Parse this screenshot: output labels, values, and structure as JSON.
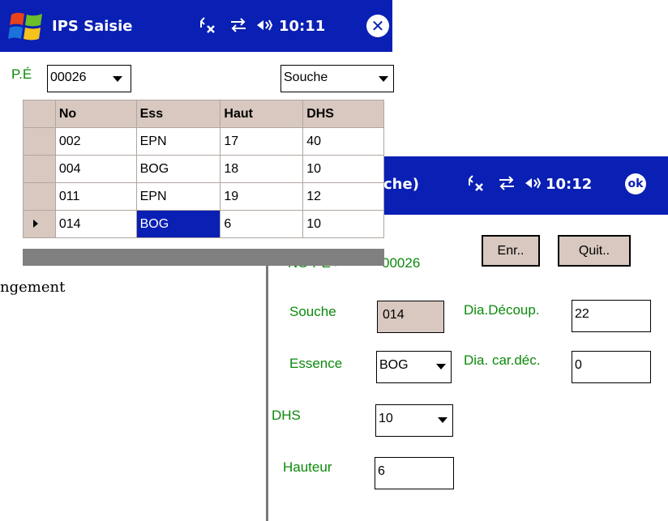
{
  "background_text": "ngement",
  "front_window": {
    "title": "IPS Saisie",
    "time": "10:11",
    "status_icons": [
      "signal-off-icon",
      "sync-icon",
      "volume-icon"
    ],
    "pe_label": "P.É",
    "pe_select": "00026",
    "type_select": "Souche",
    "grid": {
      "columns": [
        "No",
        "Ess",
        "Haut",
        "DHS"
      ],
      "rows": [
        [
          "002",
          "EPN",
          "17",
          "40"
        ],
        [
          "004",
          "BOG",
          "18",
          "10"
        ],
        [
          "011",
          "EPN",
          "19",
          "12"
        ],
        [
          "014",
          "BOG",
          "6",
          "10"
        ]
      ],
      "selected_row": 3,
      "selected_col": 1
    }
  },
  "back_window": {
    "title_fragment": "che)",
    "time": "10:12",
    "ok_label": "ok",
    "partial_label_prefix": "NO PÉ >",
    "partial_label_value": "00026",
    "save_button": "Enr..",
    "quit_button": "Quit..",
    "fields": {
      "souche_label": "Souche",
      "souche_value": "014",
      "essence_label": "Essence",
      "essence_value": "BOG",
      "dhs_label": "DHS",
      "dhs_value": "10",
      "hauteur_label": "Hauteur",
      "hauteur_value": "6",
      "dia_decoup_label": "Dia.Découp.",
      "dia_decoup_value": "22",
      "dia_car_label": "Dia. car.déc.",
      "dia_car_value": "0"
    }
  },
  "colors": {
    "titlebar": "#0a1fb3",
    "label_green": "#0b8a0b",
    "header_bg": "#d8c8c0"
  }
}
